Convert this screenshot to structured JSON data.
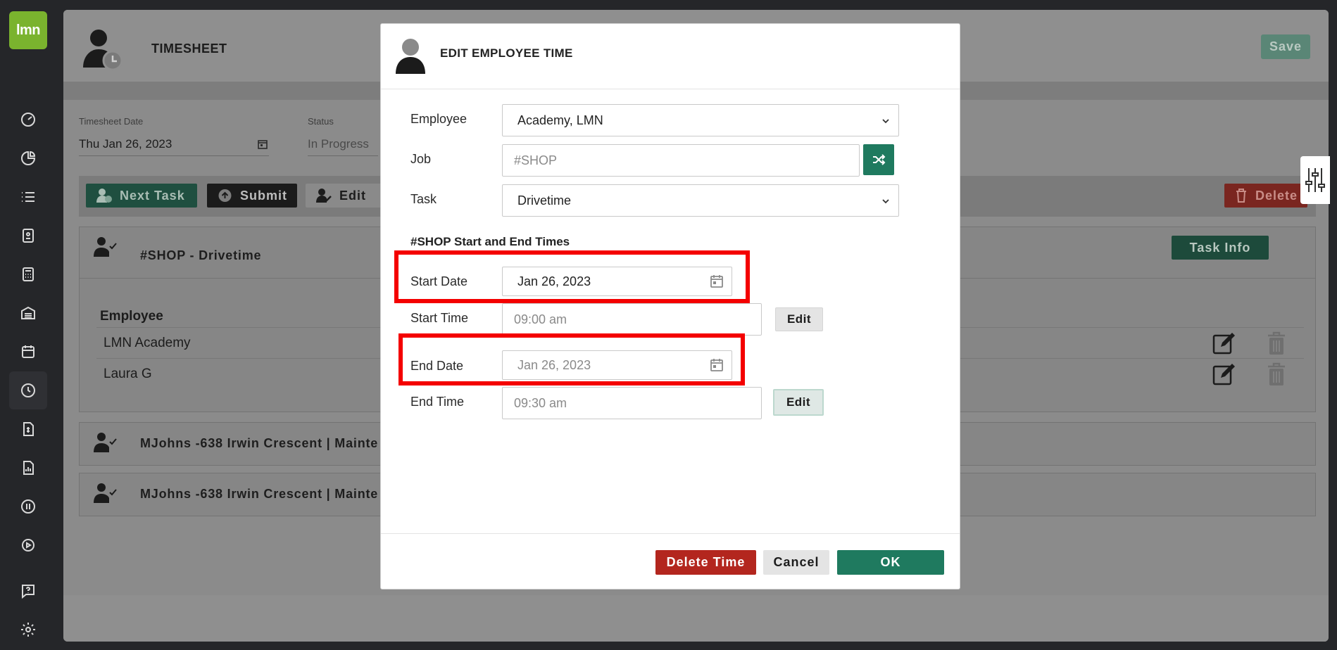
{
  "sidebar": {
    "logo_text": "lmn",
    "items": [
      {
        "name": "dashboard-icon"
      },
      {
        "name": "pie-chart-icon"
      },
      {
        "name": "list-icon"
      },
      {
        "name": "contacts-icon"
      },
      {
        "name": "calculator-icon"
      },
      {
        "name": "warehouse-icon"
      },
      {
        "name": "calendar-icon"
      },
      {
        "name": "clock-icon",
        "active": true
      },
      {
        "name": "invoice-icon"
      },
      {
        "name": "report-icon"
      },
      {
        "name": "quickbooks-icon"
      },
      {
        "name": "play-icon"
      },
      {
        "name": "help-icon"
      },
      {
        "name": "gear-icon"
      }
    ]
  },
  "header": {
    "title": "TIMESHEET",
    "save_label": "Save"
  },
  "details": {
    "date_label": "Timesheet Date",
    "date_value": "Thu Jan 26, 2023",
    "status_label": "Status",
    "status_value": "In Progress"
  },
  "toolbar": {
    "next_task": "Next Task",
    "submit": "Submit",
    "edit": "Edit",
    "delete": "Delete"
  },
  "tasks": [
    {
      "title": "#SHOP - Drivetime",
      "task_info": "Task Info",
      "employee_header": "Employee",
      "employees": [
        "LMN Academy",
        "Laura G"
      ]
    },
    {
      "title": "MJohns -638 Irwin Crescent | Mainte"
    },
    {
      "title": "MJohns -638 Irwin Crescent | Mainte"
    }
  ],
  "modal": {
    "title": "EDIT EMPLOYEE TIME",
    "employee_label": "Employee",
    "employee_value": "Academy, LMN",
    "job_label": "Job",
    "job_placeholder": "#SHOP",
    "task_label": "Task",
    "task_value": "Drivetime",
    "section_title": "#SHOP Start and End Times",
    "start_date_label": "Start Date",
    "start_date_value": "Jan 26, 2023",
    "start_time_label": "Start Time",
    "start_time_value": "09:00 am",
    "end_date_label": "End Date",
    "end_date_value": "Jan 26, 2023",
    "end_time_label": "End Time",
    "end_time_value": "09:30 am",
    "edit_label": "Edit",
    "delete_time": "Delete Time",
    "cancel": "Cancel",
    "ok": "OK"
  },
  "colors": {
    "brand_green": "#7ab32e",
    "primary": "#1f7a5f",
    "danger": "#b3261e",
    "highlight": "#f40000"
  }
}
